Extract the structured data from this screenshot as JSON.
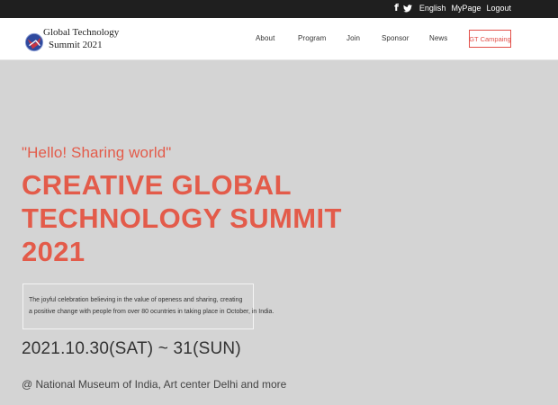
{
  "topbar": {
    "social": [
      "facebook-icon",
      "twitter-icon"
    ],
    "links": [
      "English",
      "MyPage",
      "Logout"
    ]
  },
  "logo": {
    "line1": "Global Technology",
    "line2": "Summit 2021"
  },
  "nav": {
    "items": [
      "About",
      "Program",
      "Join",
      "Sponsor",
      "News"
    ],
    "cta": "GT Campaing"
  },
  "hero": {
    "tagline": "\"Hello! Sharing world\"",
    "title_lines": [
      "CREATIVE GLOBAL",
      "TECHNOLOGY SUMMIT",
      "2021"
    ],
    "description_lines": [
      "The joyful celebration believing in the value of openess and sharing, creating",
      "a positive change with people from over 80 ocuntries in taking place in October, in India."
    ],
    "dates": "2021.10.30(SAT) ~ 31(SUN)",
    "venue": "@ National Museum of India, Art center Delhi and more"
  },
  "colors": {
    "accent": "#e35b4a",
    "topbar_bg": "#1f1f1f",
    "hero_bg": "#d4d4d4"
  }
}
